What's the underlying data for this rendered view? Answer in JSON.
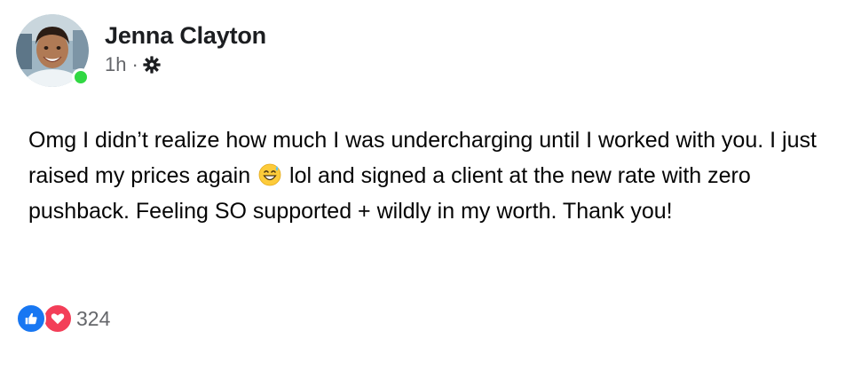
{
  "post": {
    "author": {
      "name": "Jenna Clayton",
      "avatar_icon": "person-avatar-icon",
      "online": true,
      "online_color": "#31d843"
    },
    "timestamp": "1h",
    "separator": "·",
    "privacy_icon": "gear-icon",
    "text": {
      "part1": "Omg I didn’t realize how much I was undercharging until I worked with you. I just raised my prices again ",
      "emoji": "grinning-sweat-emoji",
      "part2": " lol and signed a client at the new rate with zero pushback. Feeling SO supported + wildly in my worth. Thank you!"
    },
    "reactions": {
      "types": [
        "like-icon",
        "love-icon"
      ],
      "count": "324",
      "colors": {
        "like": "#1877f2",
        "love": "#f33e58"
      }
    }
  }
}
